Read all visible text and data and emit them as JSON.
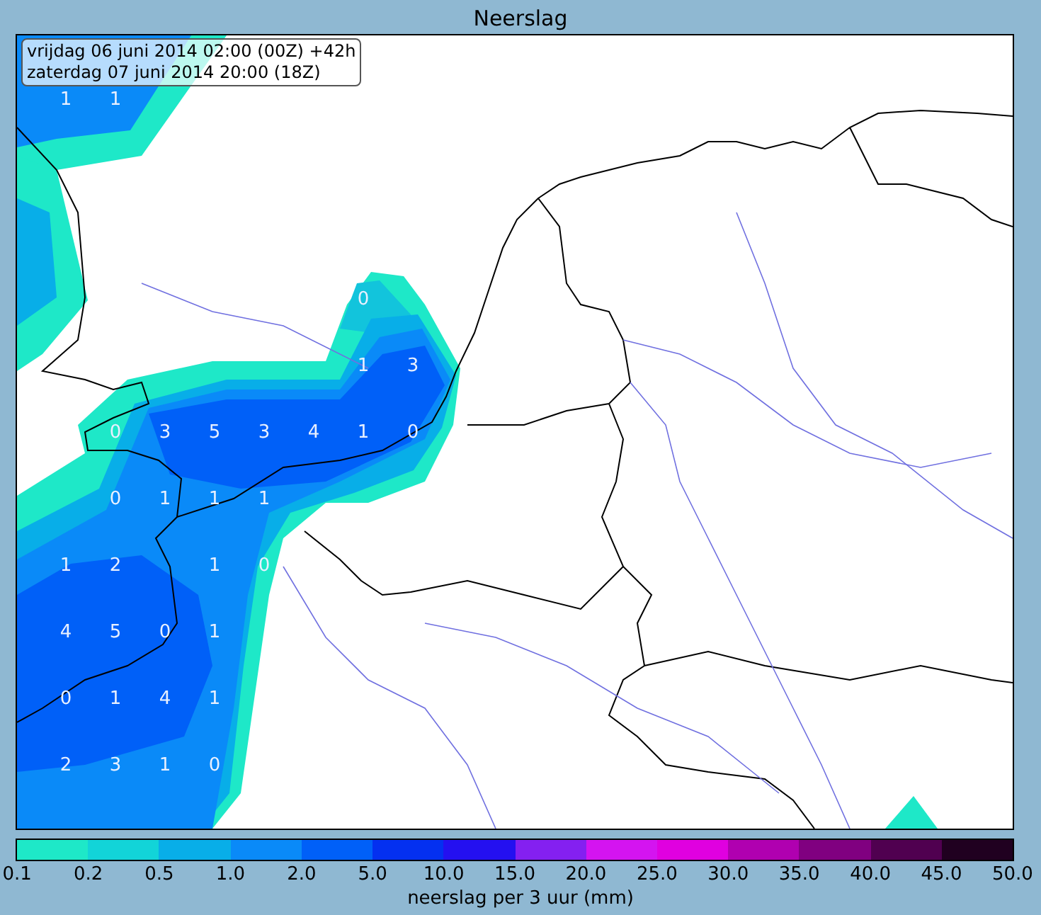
{
  "title": "Neerslag",
  "info_box": {
    "lines": [
      "vrijdag 06 juni 2014 02:00 (00Z) +42h",
      "zaterdag 07 juni 2014 20:00 (18Z)"
    ]
  },
  "map": {
    "value_grid": {
      "row_1": {
        "col_1": "1",
        "col_2": "1"
      },
      "row_4": {
        "col_7": "0"
      },
      "row_5": {
        "col_7": "1",
        "col_8": "3"
      },
      "row_6": {
        "col_2": "0",
        "col_3": "3",
        "col_4": "5",
        "col_5": "3",
        "col_6": "4",
        "col_7": "1",
        "col_8": "0"
      },
      "row_7": {
        "col_2": "0",
        "col_3": "1",
        "col_4": "1",
        "col_5": "1"
      },
      "row_8": {
        "col_1": "1",
        "col_2": "2",
        "col_4": "1",
        "col_5": "0"
      },
      "row_9": {
        "col_1": "4",
        "col_2": "5",
        "col_3": "0",
        "col_4": "1"
      },
      "row_10": {
        "col_1": "0",
        "col_2": "1",
        "col_3": "4",
        "col_4": "1"
      },
      "row_11": {
        "col_1": "2",
        "col_2": "3",
        "col_3": "1",
        "col_4": "0"
      }
    }
  },
  "colorbar": {
    "segments": [
      {
        "color": "#1ee8c8"
      },
      {
        "color": "#12d4d8"
      },
      {
        "color": "#08aee8"
      },
      {
        "color": "#0a8af8"
      },
      {
        "color": "#0060f8"
      },
      {
        "color": "#0430f0"
      },
      {
        "color": "#2410f0"
      },
      {
        "color": "#8420f0"
      },
      {
        "color": "#d414f0"
      },
      {
        "color": "#e000e0"
      },
      {
        "color": "#b000b0"
      },
      {
        "color": "#800080"
      },
      {
        "color": "#500050"
      },
      {
        "color": "#200020"
      }
    ],
    "ticks": [
      "0.1",
      "0.2",
      "0.5",
      "1.0",
      "2.0",
      "5.0",
      "10.0",
      "15.0",
      "20.0",
      "25.0",
      "30.0",
      "35.0",
      "40.0",
      "45.0",
      "50.0"
    ],
    "label": "neerslag per 3 uur (mm)"
  }
}
